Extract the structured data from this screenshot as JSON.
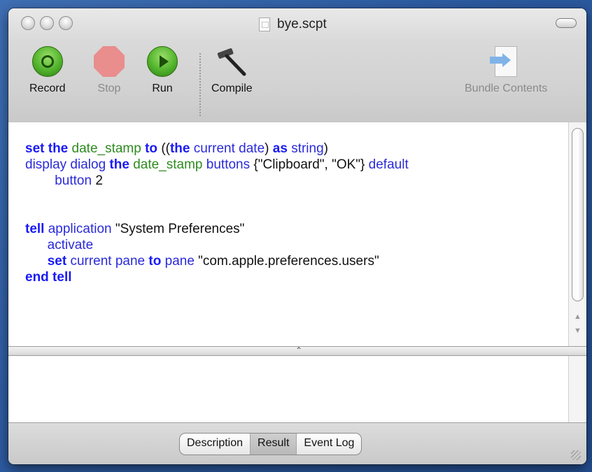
{
  "window": {
    "title": "bye.scpt"
  },
  "toolbar": {
    "record_label": "Record",
    "stop_label": "Stop",
    "run_label": "Run",
    "compile_label": "Compile",
    "bundle_label": "Bundle Contents"
  },
  "code": {
    "l1": [
      {
        "t": "set the",
        "c": "kw"
      },
      {
        "t": " ",
        "c": "str"
      },
      {
        "t": "date_stamp",
        "c": "var"
      },
      {
        "t": " ",
        "c": "str"
      },
      {
        "t": "to",
        "c": "kw"
      },
      {
        "t": " ((",
        "c": "str"
      },
      {
        "t": "the",
        "c": "kw"
      },
      {
        "t": " ",
        "c": "str"
      },
      {
        "t": "current date",
        "c": "fn"
      },
      {
        "t": ") ",
        "c": "str"
      },
      {
        "t": "as",
        "c": "kw"
      },
      {
        "t": " ",
        "c": "str"
      },
      {
        "t": "string",
        "c": "fn"
      },
      {
        "t": ")",
        "c": "str"
      }
    ],
    "l2": [
      {
        "t": "display dialog",
        "c": "fn"
      },
      {
        "t": " ",
        "c": "str"
      },
      {
        "t": "the",
        "c": "kw"
      },
      {
        "t": " ",
        "c": "str"
      },
      {
        "t": "date_stamp",
        "c": "var"
      },
      {
        "t": " ",
        "c": "str"
      },
      {
        "t": "buttons",
        "c": "fn"
      },
      {
        "t": " {\"Clipboard\", \"OK\"} ",
        "c": "str"
      },
      {
        "t": "default",
        "c": "fn"
      }
    ],
    "l3": [
      {
        "t": "        button",
        "c": "fn"
      },
      {
        "t": " 2",
        "c": "str"
      }
    ],
    "l4": [],
    "l5": [],
    "l6": [
      {
        "t": "tell",
        "c": "kw"
      },
      {
        "t": " ",
        "c": "str"
      },
      {
        "t": "application",
        "c": "fn"
      },
      {
        "t": " \"System Preferences\"",
        "c": "str"
      }
    ],
    "l7": [
      {
        "t": "      activate",
        "c": "fn"
      }
    ],
    "l8": [
      {
        "t": "      ",
        "c": "str"
      },
      {
        "t": "set",
        "c": "kw"
      },
      {
        "t": " ",
        "c": "str"
      },
      {
        "t": "current pane",
        "c": "fn"
      },
      {
        "t": " ",
        "c": "str"
      },
      {
        "t": "to",
        "c": "kw"
      },
      {
        "t": " ",
        "c": "str"
      },
      {
        "t": "pane",
        "c": "fn"
      },
      {
        "t": " \"com.apple.preferences.users\"",
        "c": "str"
      }
    ],
    "l9": [
      {
        "t": "end tell",
        "c": "kw"
      }
    ]
  },
  "bottom_tabs": {
    "description": "Description",
    "result": "Result",
    "event_log": "Event Log",
    "selected": "Result"
  },
  "icons": {
    "record": "record-icon",
    "stop": "stop-icon",
    "run": "run-icon",
    "compile": "hammer-icon",
    "bundle": "bundle-contents-icon"
  }
}
